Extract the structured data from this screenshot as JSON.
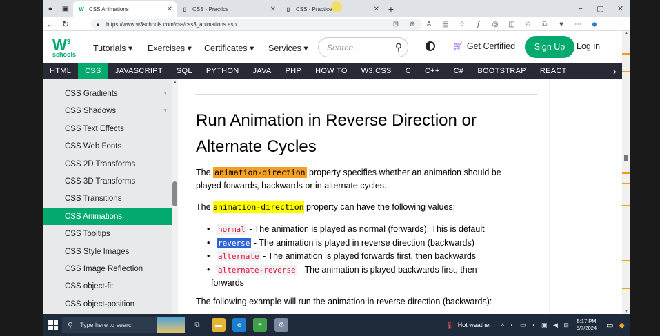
{
  "browser": {
    "tabs": [
      {
        "label": "CSS Animations",
        "favicon": "W",
        "active": true
      },
      {
        "label": "CSS - Practice",
        "favicon": "doc",
        "active": false
      },
      {
        "label": "CSS - Practice",
        "favicon": "doc",
        "active": false
      }
    ],
    "new_tab": "+",
    "window_controls": {
      "minimize": "−",
      "maximize": "▢",
      "close": "✕"
    },
    "url": "https://www.w3schools.com/css/css3_animations.asp"
  },
  "site": {
    "logo": {
      "mark": "W",
      "sup": "3",
      "sub": "schools"
    },
    "menu": [
      "Tutorials ▾",
      "Exercises ▾",
      "Certificates ▾",
      "Services ▾"
    ],
    "search_placeholder": "Search...",
    "get_certified": "Get Certified",
    "sign_up": "Sign Up",
    "log_in": "Log in",
    "topnav": [
      "HTML",
      "CSS",
      "JAVASCRIPT",
      "SQL",
      "PYTHON",
      "JAVA",
      "PHP",
      "HOW TO",
      "W3.CSS",
      "C",
      "C++",
      "C#",
      "BOOTSTRAP",
      "REACT"
    ],
    "topnav_active": "CSS"
  },
  "sidebar": {
    "items": [
      {
        "label": "CSS Gradients",
        "caret": true
      },
      {
        "label": "CSS Shadows",
        "caret": true
      },
      {
        "label": "CSS Text Effects"
      },
      {
        "label": "CSS Web Fonts"
      },
      {
        "label": "CSS 2D Transforms"
      },
      {
        "label": "CSS 3D Transforms"
      },
      {
        "label": "CSS Transitions"
      },
      {
        "label": "CSS Animations",
        "active": true
      },
      {
        "label": "CSS Tooltips"
      },
      {
        "label": "CSS Style Images"
      },
      {
        "label": "CSS Image Reflection"
      },
      {
        "label": "CSS object-fit"
      },
      {
        "label": "CSS object-position"
      }
    ]
  },
  "content": {
    "heading": "Run Animation in Reverse Direction or Alternate Cycles",
    "p1": {
      "before": "The ",
      "code": "animation-direction",
      "after": " property specifies whether an animation should be played forwards, backwards or in alternate cycles."
    },
    "p2": {
      "before": "The ",
      "code": "animation-direction",
      "after": " property can have the following values:"
    },
    "values": [
      {
        "code": "normal",
        "text": " - The animation is played as normal (forwards). This is default"
      },
      {
        "code": "reverse",
        "text": " - The animation is played in reverse direction (backwards)",
        "selected": true
      },
      {
        "code": "alternate",
        "text": " - The animation is played forwards first, then backwards"
      },
      {
        "code": "alternate-reverse",
        "text": " - The animation is played backwards first, then",
        "wrap": "forwards"
      }
    ],
    "p3": "The following example will run the animation in reverse direction (backwards):"
  },
  "taskbar": {
    "search_placeholder": "Type here to search",
    "weather": "Hot weather",
    "time": "5:17 PM",
    "date": "5/7/2024"
  },
  "colors": {
    "brand": "#04AA6D",
    "topnav": "#282A35",
    "highlight_orange": "#f4a025",
    "highlight_yellow": "#ffff00"
  }
}
